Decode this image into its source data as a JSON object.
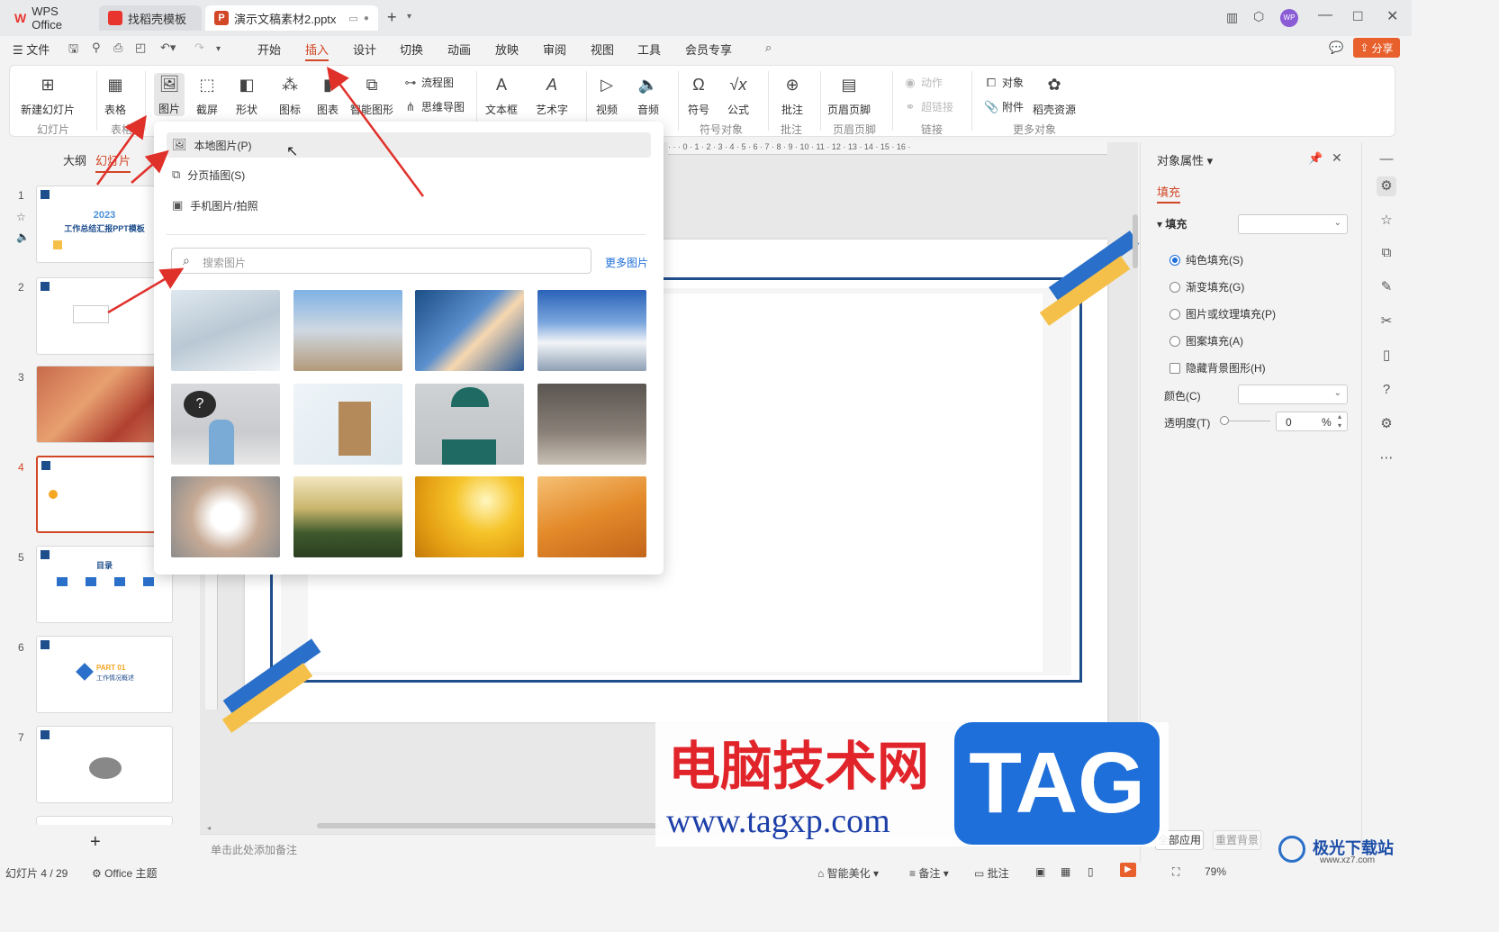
{
  "titlebar": {
    "tabs": [
      {
        "label": "WPS Office",
        "color": "#e8352e"
      },
      {
        "label": "找稻壳模板",
        "color": "#e8352e"
      },
      {
        "label": "演示文稿素材2.pptx",
        "color": "#d24726"
      }
    ],
    "new_tab": "+",
    "avatar": "WP"
  },
  "menubar": {
    "file": "文件",
    "tabs": [
      "开始",
      "插入",
      "设计",
      "切换",
      "动画",
      "放映",
      "审阅",
      "视图",
      "工具",
      "会员专享"
    ],
    "active_tab": "插入",
    "share": "分享"
  },
  "ribbon": {
    "new_slide": "新建幻灯片",
    "table": "表格",
    "picture": "图片",
    "screenshot": "截屏",
    "shape": "形状",
    "icon": "图标",
    "chart": "图表",
    "smartart": "智能图形",
    "flowchart": "流程图",
    "mindmap": "思维导图",
    "textbox": "文本框",
    "wordart": "艺术字",
    "video": "视频",
    "audio": "音频",
    "symbol": "符号",
    "formula": "公式",
    "comment": "批注",
    "header_footer": "页眉页脚",
    "action": "动作",
    "hyperlink": "超链接",
    "object": "对象",
    "attachment": "附件",
    "docer": "稻壳资源",
    "groups": {
      "slide": "幻灯片",
      "table": "表格",
      "symbol_obj": "符号对象",
      "comment": "批注",
      "header_footer": "页眉页脚",
      "link": "链接",
      "more": "更多对象"
    }
  },
  "leftpanel": {
    "outline_tab": "大纲",
    "slides_tab": "幻灯片",
    "slide_numbers": [
      "1",
      "2",
      "3",
      "4",
      "5",
      "6",
      "7"
    ],
    "slide1_year": "2023",
    "slide1_title": "工作总结汇报PPT模板",
    "slide5_title": "目录",
    "slide6_part": "PART 01",
    "slide6_title": "工作情况概述",
    "add": "+"
  },
  "dropdown": {
    "items": [
      {
        "label": "本地图片(P)",
        "icon": "image-icon"
      },
      {
        "label": "分页插图(S)",
        "icon": "paged-image-icon"
      },
      {
        "label": "手机图片/拍照",
        "icon": "phone-image-icon"
      }
    ],
    "search_placeholder": "搜索图片",
    "more_pictures": "更多图片"
  },
  "canvas": {
    "notes_placeholder": "单击此处添加备注"
  },
  "rightpanel": {
    "title": "对象属性",
    "tab_fill": "填充",
    "section_fill": "填充",
    "options": [
      "纯色填充(S)",
      "渐变填充(G)",
      "图片或纹理填充(P)",
      "图案填充(A)"
    ],
    "selected_option": 0,
    "hide_bg": "隐藏背景图形(H)",
    "color_label": "颜色(C)",
    "transparency_label": "透明度(T)",
    "transparency_value": "0",
    "transparency_unit": "%",
    "apply_all": "全部应用",
    "reset_bg": "重置背景"
  },
  "statusbar": {
    "slide_info": "幻灯片 4 / 29",
    "theme": "Office 主题",
    "beautify": "智能美化",
    "notes": "备注",
    "comment": "批注",
    "zoom": "79%"
  },
  "watermark": {
    "title": "电脑技术网",
    "url": "www.tagxp.com",
    "badge": "TAG",
    "corner": "极光下载站",
    "corner_url": "www.xz7.com"
  },
  "colors": {
    "accent": "#d24726",
    "blue": "#1e6fd9",
    "slide_blue": "#1f4e8c",
    "slide_yellow": "#f5c04a"
  }
}
